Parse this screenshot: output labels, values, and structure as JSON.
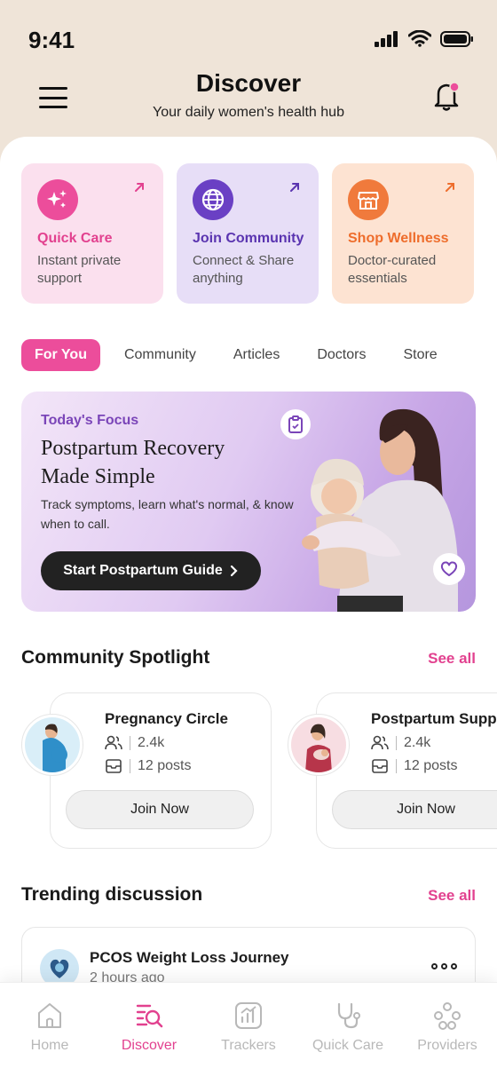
{
  "status_bar": {
    "time": "9:41"
  },
  "header": {
    "title": "Discover",
    "subtitle": "Your daily women's health hub"
  },
  "quick_cards": [
    {
      "title": "Quick Care",
      "desc": "Instant private support",
      "icon": "sparkle-icon",
      "color": "#ec4d9b"
    },
    {
      "title": "Join Community",
      "desc": "Connect & Share anything",
      "icon": "globe-icon",
      "color": "#6a40c4"
    },
    {
      "title": "Shop Wellness",
      "desc": "Doctor-curated essentials",
      "icon": "store-icon",
      "color": "#f07a3c"
    }
  ],
  "tabs": [
    "For You",
    "Community",
    "Articles",
    "Doctors",
    "Store"
  ],
  "active_tab": "For You",
  "banner": {
    "label": "Today's Focus",
    "title": "Postpartum Recovery Made Simple",
    "desc": "Track symptoms, learn what's normal, & know when to call.",
    "button": "Start Postpartum Guide"
  },
  "community": {
    "title": "Community Spotlight",
    "see_all": "See all",
    "cards": [
      {
        "name": "Pregnancy Circle",
        "members": "2.4k",
        "posts": "12 posts",
        "join": "Join Now"
      },
      {
        "name": "Postpartum Supp",
        "members": "2.4k",
        "posts": "12 posts",
        "join": "Join Now"
      }
    ]
  },
  "trending": {
    "title": "Trending discussion",
    "see_all": "See all",
    "item": {
      "title": "PCOS Weight Loss Journey",
      "time": "2 hours ago"
    }
  },
  "bottom_nav": [
    {
      "label": "Home",
      "icon": "home-icon"
    },
    {
      "label": "Discover",
      "icon": "discover-icon"
    },
    {
      "label": "Trackers",
      "icon": "chart-icon"
    },
    {
      "label": "Quick Care",
      "icon": "stethoscope-icon"
    },
    {
      "label": "Providers",
      "icon": "providers-icon"
    }
  ],
  "accent": "#ec4d9b"
}
